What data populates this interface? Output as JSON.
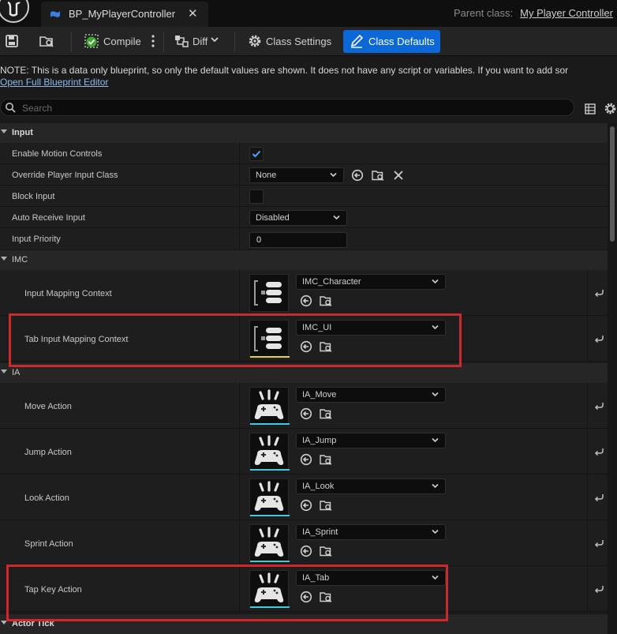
{
  "titlebar": {
    "tab_title": "BP_MyPlayerController",
    "close_glyph": "✕",
    "parent_label": "Parent class:",
    "parent_value": "My Player Controller"
  },
  "toolbar": {
    "compile_label": "Compile",
    "diff_label": "Diff",
    "class_settings_label": "Class Settings",
    "class_defaults_label": "Class Defaults",
    "active_tab": "Class Defaults",
    "accent_color": "#0b68d6"
  },
  "notice": {
    "text": "NOTE: This is a data only blueprint, so only the default values are shown.  It does not have any script or variables.  If you want to add sor",
    "link": "Open Full Blueprint Editor"
  },
  "search": {
    "placeholder": "Search"
  },
  "categories": {
    "input": "Input",
    "imc": "IMC",
    "ia": "IA",
    "actor_tick": "Actor Tick"
  },
  "input_props": {
    "enable_motion_controls": {
      "label": "Enable Motion Controls",
      "checked": true
    },
    "override_player_input_class": {
      "label": "Override Player Input Class",
      "value": "None"
    },
    "block_input": {
      "label": "Block Input",
      "checked": false
    },
    "auto_receive_input": {
      "label": "Auto Receive Input",
      "value": "Disabled"
    },
    "input_priority": {
      "label": "Input Priority",
      "value": "0"
    }
  },
  "imc_props": [
    {
      "label": "Input Mapping Context",
      "value": "IMC_Character"
    },
    {
      "label": "Tab Input Mapping Context",
      "value": "IMC_UI"
    }
  ],
  "ia_props": [
    {
      "label": "Move Action",
      "value": "IA_Move"
    },
    {
      "label": "Jump Action",
      "value": "IA_Jump"
    },
    {
      "label": "Look Action",
      "value": "IA_Look"
    },
    {
      "label": "Sprint Action",
      "value": "IA_Sprint"
    },
    {
      "label": "Tap Key Action",
      "value": "IA_Tab"
    }
  ],
  "colors": {
    "highlight": "#d0272d",
    "imc_asset_bar": "#e6d33a",
    "ia_asset_bar": "#49c6d8"
  }
}
